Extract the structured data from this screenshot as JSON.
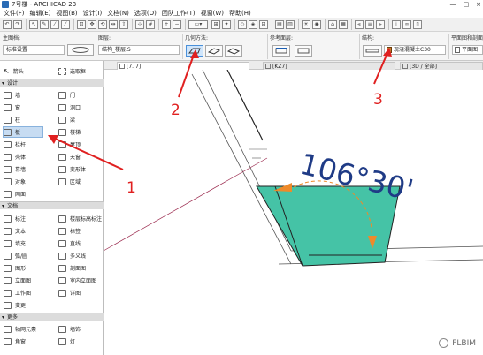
{
  "title_bar": {
    "title": "7号楼 - ARCHICAD 23",
    "controls": [
      "—",
      "□",
      "×"
    ]
  },
  "menu": [
    "文件(F)",
    "编辑(E)",
    "视图(B)",
    "设计(I)",
    "文档(N)",
    "选项(O)",
    "团队工作(T)",
    "视窗(W)",
    "帮助(H)"
  ],
  "infobox": {
    "main_layer_label": "主图档:",
    "main_layer_value": "标准设置",
    "layer_label": "图层:",
    "layer_value": "结构_楼层.S",
    "geometry_label": "几何方法:",
    "ref_label": "参考面层:",
    "structure_label": "结构:",
    "structure_value": "现浇混凝土C30",
    "floorplan_label": "平面图和剖面图:",
    "floorplan_value": "平面图"
  },
  "toolbox": {
    "arrow": "箭头",
    "marquee": "选取框",
    "sections": {
      "design": "设计",
      "document": "文档",
      "more": "更多"
    },
    "design_tools": [
      [
        "墙",
        "门"
      ],
      [
        "窗",
        "洞口"
      ],
      [
        "柱",
        "梁"
      ],
      [
        "板",
        "楼梯"
      ],
      [
        "栏杆",
        "屋顶"
      ],
      [
        "壳体",
        "天窗"
      ],
      [
        "幕墙",
        "变形体"
      ],
      [
        "对象",
        "区域"
      ],
      [
        "网面",
        ""
      ]
    ],
    "doc_tools": [
      [
        "标注",
        "楼层标高标注"
      ],
      [
        "文本",
        "标签"
      ],
      [
        "填充",
        "直线"
      ],
      [
        "弧/圆",
        "多义线"
      ],
      [
        "图形",
        "剖面图"
      ],
      [
        "立面图",
        "室内立面图"
      ],
      [
        "工作图",
        "详图"
      ],
      [
        "变更",
        ""
      ]
    ],
    "more_tools": [
      [
        "轴网元素",
        "墙饰"
      ],
      [
        "角窗",
        "灯"
      ],
      [
        "",
        ""
      ]
    ]
  },
  "tabs": [
    {
      "label": "[7. 7]"
    },
    {
      "label": "[KZ7]"
    },
    {
      "label": "[3D / 全部]"
    }
  ],
  "canvas": {
    "angle_label": "106°30'"
  },
  "annotations": [
    "1",
    "2",
    "3"
  ],
  "colors": {
    "slab_fill": "#45c3a6",
    "arrow_red": "#e02020",
    "angle_text": "#1f3b86",
    "orange": "#ee8a2a"
  },
  "watermark": {
    "text": "FLBIM"
  }
}
